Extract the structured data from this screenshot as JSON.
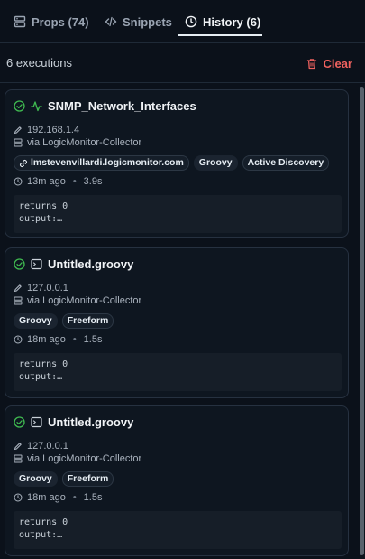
{
  "tabs": [
    {
      "label": "Props (74)",
      "icon": "server-icon"
    },
    {
      "label": "Snippets",
      "icon": "code-icon"
    },
    {
      "label": "History (6)",
      "icon": "clock-icon",
      "active": true
    }
  ],
  "summary": {
    "count_text": "6 executions",
    "clear_label": "Clear"
  },
  "colors": {
    "success": "#3fb950",
    "danger": "#f0625f",
    "accent_tab": "#e6edf3"
  },
  "history": [
    {
      "title": "SNMP_Network_Interfaces",
      "status": "success",
      "type_icon": "activity-icon",
      "host": "192.168.1.4",
      "collector": "via LogicMonitor-Collector",
      "tags": [
        "lmstevenvillardi.logicmonitor.com",
        "Groovy",
        "Active Discovery"
      ],
      "ago": "13m ago",
      "duration": "3.9s",
      "output": [
        "returns 0",
        "output:…"
      ]
    },
    {
      "title": "Untitled.groovy",
      "status": "success",
      "type_icon": "terminal-icon",
      "host": "127.0.0.1",
      "collector": "via LogicMonitor-Collector",
      "tags": [
        "Groovy",
        "Freeform"
      ],
      "ago": "18m ago",
      "duration": "1.5s",
      "output": [
        "returns 0",
        "output:…"
      ]
    },
    {
      "title": "Untitled.groovy",
      "status": "success",
      "type_icon": "terminal-icon",
      "host": "127.0.0.1",
      "collector": "via LogicMonitor-Collector",
      "tags": [
        "Groovy",
        "Freeform"
      ],
      "ago": "18m ago",
      "duration": "1.5s",
      "output": [
        "returns 0",
        "output:…"
      ]
    }
  ]
}
